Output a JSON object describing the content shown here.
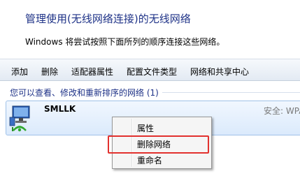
{
  "header": {
    "title": "管理使用(无线网络连接)的无线网络",
    "description": "Windows 将尝试按照下面所列的顺序连接这些网络。"
  },
  "toolbar": {
    "items": [
      "添加",
      "删除",
      "适配器属性",
      "配置文件类型",
      "网络和共享中心"
    ]
  },
  "list": {
    "group_header": "您可以查看、修改和重新排序的网络 (1)",
    "networks": [
      {
        "name": "SMLLK",
        "security": "安全: WPA",
        "icon": "wireless-network-icon"
      }
    ]
  },
  "context_menu": {
    "items": [
      "属性",
      "删除网络",
      "重命名"
    ],
    "highlighted": "删除网络",
    "highlight_color": "#e2312e"
  }
}
